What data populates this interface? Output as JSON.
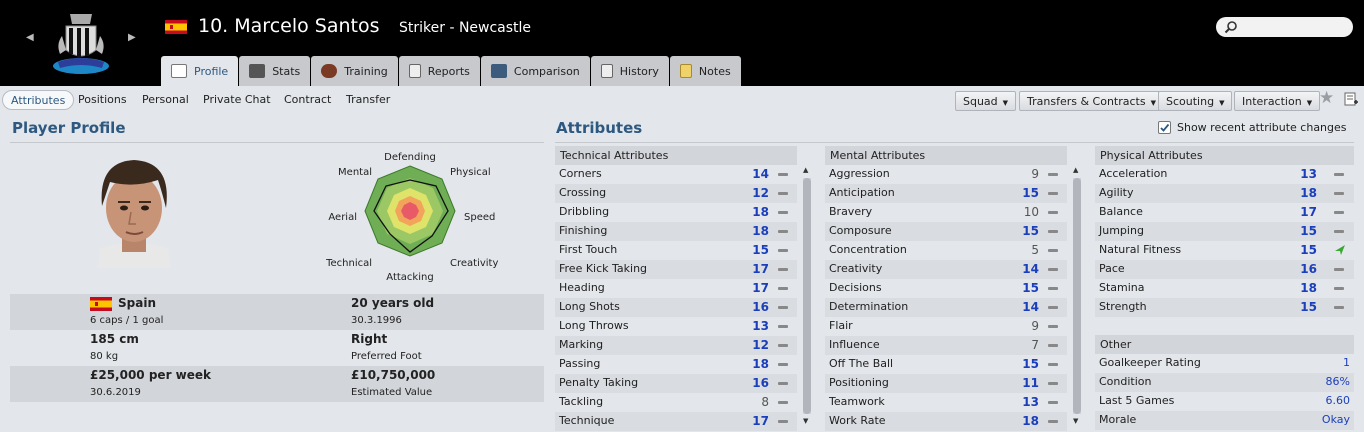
{
  "header": {
    "number": "10.",
    "name": "Marcelo Santos",
    "position_club": "Striker - Newcastle",
    "prev_icon": "chevron-left-icon",
    "next_icon": "chevron-right-icon",
    "search_icon": "search-icon"
  },
  "tabs": [
    {
      "label": "Profile",
      "icon": "profile-icon",
      "active": true
    },
    {
      "label": "Stats",
      "icon": "stats-icon"
    },
    {
      "label": "Training",
      "icon": "training-ball-icon"
    },
    {
      "label": "Reports",
      "icon": "reports-icon"
    },
    {
      "label": "Comparison",
      "icon": "comparison-icon"
    },
    {
      "label": "History",
      "icon": "history-icon"
    },
    {
      "label": "Notes",
      "icon": "notes-icon"
    }
  ],
  "subnav": [
    "Attributes",
    "Positions",
    "Personal",
    "Private Chat",
    "Contract",
    "Transfer"
  ],
  "action_buttons": [
    "Squad",
    "Transfers & Contracts",
    "Scouting",
    "Interaction"
  ],
  "action_icons": [
    "star-icon",
    "add-note-icon"
  ],
  "profile": {
    "heading": "Player Profile",
    "radar_labels": [
      "Defending",
      "Physical",
      "Speed",
      "Creativity",
      "Attacking",
      "Technical",
      "Aerial",
      "Mental"
    ],
    "nationality": "Spain",
    "caps": "6 caps / 1 goal",
    "age": "20 years old",
    "dob": "30.3.1996",
    "height": "185 cm",
    "weight": "80 kg",
    "foot": "Right",
    "foot_label": "Preferred Foot",
    "wage": "£25,000 per week",
    "contract_end": "30.6.2019",
    "value": "£10,750,000",
    "value_label": "Estimated Value"
  },
  "attributes": {
    "heading": "Attributes",
    "show_changes_label": "Show recent attribute changes",
    "show_changes_checked": true,
    "technical": {
      "title": "Technical Attributes",
      "rows": [
        {
          "name": "Corners",
          "value": "14"
        },
        {
          "name": "Crossing",
          "value": "12"
        },
        {
          "name": "Dribbling",
          "value": "18"
        },
        {
          "name": "Finishing",
          "value": "18"
        },
        {
          "name": "First Touch",
          "value": "15"
        },
        {
          "name": "Free Kick Taking",
          "value": "17"
        },
        {
          "name": "Heading",
          "value": "17"
        },
        {
          "name": "Long Shots",
          "value": "16"
        },
        {
          "name": "Long Throws",
          "value": "13"
        },
        {
          "name": "Marking",
          "value": "12"
        },
        {
          "name": "Passing",
          "value": "18"
        },
        {
          "name": "Penalty Taking",
          "value": "16"
        },
        {
          "name": "Tackling",
          "value": "8"
        },
        {
          "name": "Technique",
          "value": "17"
        }
      ]
    },
    "mental": {
      "title": "Mental Attributes",
      "rows": [
        {
          "name": "Aggression",
          "value": "9"
        },
        {
          "name": "Anticipation",
          "value": "15"
        },
        {
          "name": "Bravery",
          "value": "10"
        },
        {
          "name": "Composure",
          "value": "15"
        },
        {
          "name": "Concentration",
          "value": "5"
        },
        {
          "name": "Creativity",
          "value": "14"
        },
        {
          "name": "Decisions",
          "value": "15"
        },
        {
          "name": "Determination",
          "value": "14"
        },
        {
          "name": "Flair",
          "value": "9"
        },
        {
          "name": "Influence",
          "value": "7"
        },
        {
          "name": "Off The Ball",
          "value": "15"
        },
        {
          "name": "Positioning",
          "value": "11"
        },
        {
          "name": "Teamwork",
          "value": "13"
        },
        {
          "name": "Work Rate",
          "value": "18"
        }
      ]
    },
    "physical": {
      "title": "Physical Attributes",
      "rows": [
        {
          "name": "Acceleration",
          "value": "13",
          "trend": "dash"
        },
        {
          "name": "Agility",
          "value": "18",
          "trend": "dash"
        },
        {
          "name": "Balance",
          "value": "17",
          "trend": "dash"
        },
        {
          "name": "Jumping",
          "value": "15",
          "trend": "dash"
        },
        {
          "name": "Natural Fitness",
          "value": "15",
          "trend": "up-arrow-icon"
        },
        {
          "name": "Pace",
          "value": "16",
          "trend": "dash"
        },
        {
          "name": "Stamina",
          "value": "18",
          "trend": "dash"
        },
        {
          "name": "Strength",
          "value": "15",
          "trend": "dash"
        }
      ]
    },
    "other": {
      "title": "Other",
      "rows": [
        {
          "name": "Goalkeeper Rating",
          "value": "1"
        },
        {
          "name": "Condition",
          "value": "86%"
        },
        {
          "name": "Last 5 Games",
          "value": "6.60"
        },
        {
          "name": "Morale",
          "value": "Okay"
        }
      ]
    }
  },
  "colors": {
    "accent": "#2d5880",
    "high_value": "#1b3fbb",
    "header_bg": "#000000",
    "trend_up": "#3aa832"
  }
}
